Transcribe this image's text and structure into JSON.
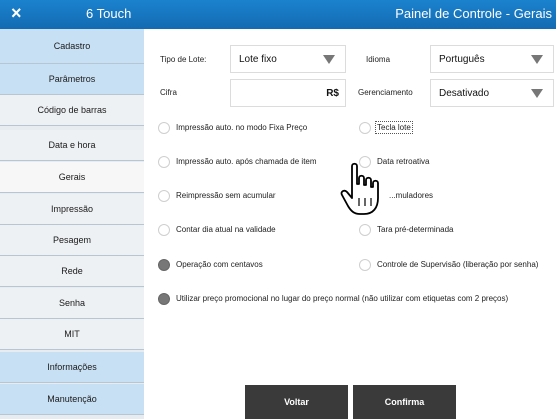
{
  "header": {
    "device_title": "6 Touch",
    "panel_title": "Painel de Controle - Gerais",
    "close_icon": "×"
  },
  "sidebar": {
    "items": [
      {
        "label": "Cadastro"
      },
      {
        "label": "Parâmetros"
      },
      {
        "label": "Código de barras"
      },
      {
        "label": "Data e hora"
      },
      {
        "label": "Gerais"
      },
      {
        "label": "Impressão"
      },
      {
        "label": "Pesagem"
      },
      {
        "label": "Rede"
      },
      {
        "label": "Senha"
      },
      {
        "label": "MIT"
      },
      {
        "label": "Informações"
      },
      {
        "label": "Manutenção"
      }
    ],
    "active": "Gerais"
  },
  "form": {
    "tipo_lote_label": "Tipo de Lote:",
    "tipo_lote_value": "Lote fixo",
    "idioma_label": "Idioma",
    "idioma_value": "Português",
    "cifra_label": "Cifra",
    "cifra_value": "R$",
    "gerenciamento_label": "Gerenciamento",
    "gerenciamento_value": "Desativado"
  },
  "options": [
    {
      "label": "Impressão auto. no modo Fixa Preço",
      "checked": false
    },
    {
      "label": "Tecla lote",
      "checked": false
    },
    {
      "label": "Impressão auto. após chamada de item",
      "checked": false
    },
    {
      "label": "Data retroativa",
      "checked": false
    },
    {
      "label": "Reimpressão sem acumular",
      "checked": false
    },
    {
      "label": "...muladores",
      "checked": false
    },
    {
      "label": "Contar dia atual na validade",
      "checked": false
    },
    {
      "label": "Tara pré-determinada",
      "checked": false
    },
    {
      "label": "Operação com centavos",
      "checked": true
    },
    {
      "label": "Controle de Supervisão (liberação por senha)",
      "checked": false
    },
    {
      "label": "Utilizar preço promocional no lugar do preço normal (não utilizar com etiquetas com 2 preços)",
      "checked": true
    }
  ],
  "buttons": {
    "back": "Voltar",
    "confirm": "Confirma"
  },
  "cursor": {
    "icon": "hand-pointer-icon"
  }
}
